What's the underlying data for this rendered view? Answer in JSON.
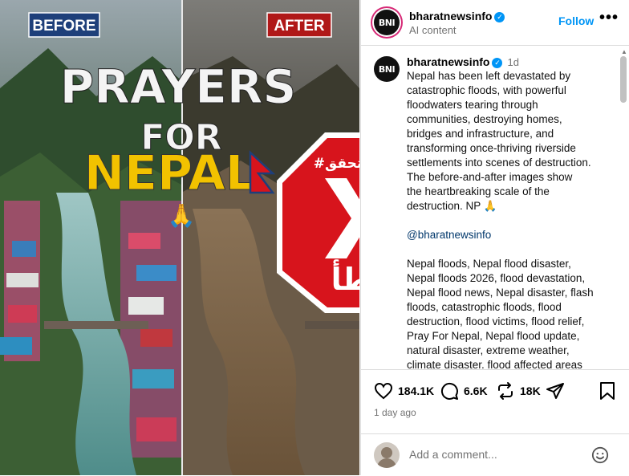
{
  "post": {
    "username": "bharatnewsinfo",
    "avatar_text": "BNI",
    "header_subtitle": "AI content",
    "follow_label": "Follow",
    "more_label": "•••",
    "caption_time": "1d",
    "caption_lines": [
      "Nepal has been left devastated by",
      "catastrophic floods, with powerful",
      "floodwaters tearing through",
      "communities, destroying homes,",
      "bridges and infrastructure, and",
      "transforming once-thriving riverside",
      "settlements into scenes of destruction.",
      "The before-and-after images show",
      "the heartbreaking scale of the",
      "destruction. NP 🙏"
    ],
    "mention": "@bharatnewsinfo",
    "hashtag_lines": [
      "Nepal floods, Nepal flood disaster,",
      "Nepal floods 2026, flood devastation,",
      "Nepal flood news, Nepal disaster, flash",
      "floods, catastrophic floods, flood",
      "destruction, flood victims, flood relief,",
      "Pray For Nepal, Nepal flood update,",
      "natural disaster, extreme weather,",
      "climate disaster, flood affected areas"
    ],
    "likes": "184.1K",
    "comments": "6.6K",
    "reposts": "18K",
    "posted_ago": "1 day ago",
    "comment_placeholder": "Add a comment..."
  },
  "image": {
    "before_label": "BEFORE",
    "after_label": "AFTER",
    "headline_1": "PRAYERS",
    "headline_2": "FOR",
    "headline_3": "NEPAL",
    "stamp_tag": "#النهار_تتحقق",
    "stamp_word": "خطأ"
  },
  "colors": {
    "accent_blue": "#0095f6",
    "stamp_red": "#d7141c",
    "headline_yellow": "#f2c200",
    "label_blue": "#1e3f7a",
    "label_red": "#b01818"
  },
  "icons": [
    "heart-icon",
    "comment-icon",
    "repost-icon",
    "share-icon",
    "bookmark-icon",
    "emoji-icon",
    "verified-icon",
    "more-icon"
  ]
}
